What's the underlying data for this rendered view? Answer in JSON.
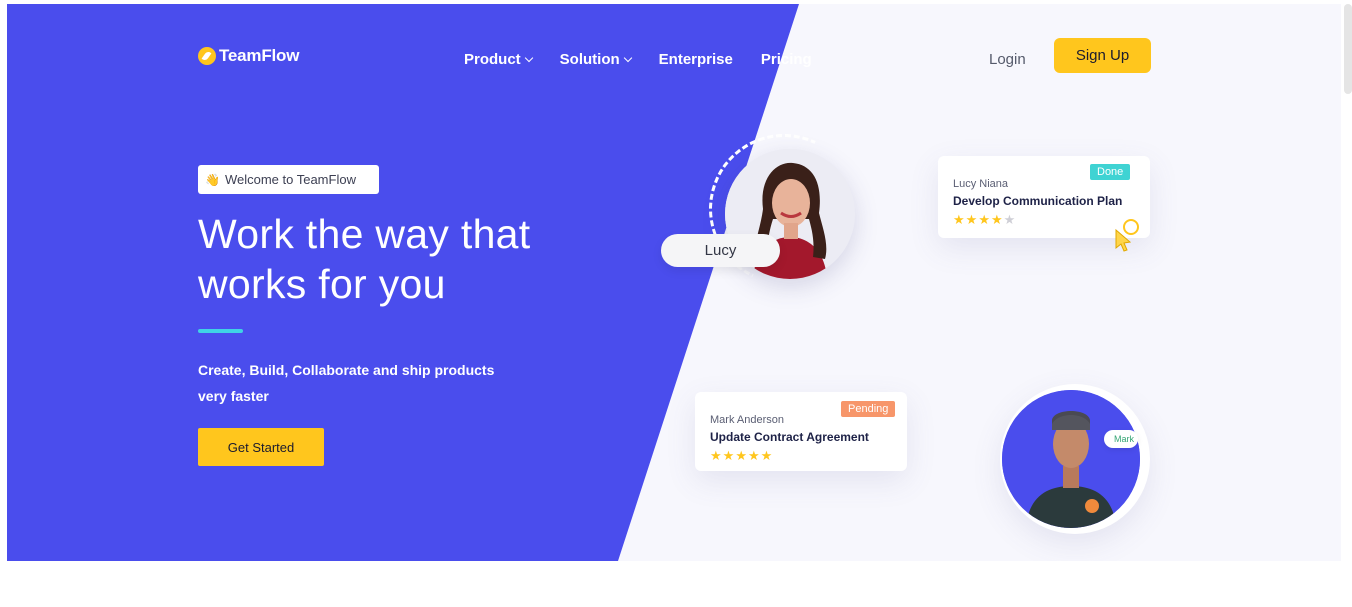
{
  "brand": {
    "name": "TeamFlow",
    "accent": "#ffc61d",
    "primary": "#4a4ded"
  },
  "nav": {
    "items": [
      {
        "label": "Product",
        "has_dropdown": true
      },
      {
        "label": "Solution",
        "has_dropdown": true
      },
      {
        "label": "Enterprise",
        "has_dropdown": false
      },
      {
        "label": "Pricing",
        "has_dropdown": false
      }
    ],
    "login": "Login",
    "signup": "Sign Up"
  },
  "hero": {
    "badge": "Welcome to TeamFlow",
    "badge_icon": "waving-hand-icon",
    "headline_line1": "Work the way that",
    "headline_line2": "works for you",
    "sub_line1": "Create, Build, Collaborate and ship products",
    "sub_line2": "very faster",
    "cta": "Get Started"
  },
  "illustration": {
    "lucy_label": "Lucy",
    "mark_label": "Mark",
    "cards": [
      {
        "name": "Lucy Niana",
        "task": "Develop Communication Plan",
        "status": "Done",
        "status_color": "#3fd3d3",
        "rating": 4,
        "max": 5
      },
      {
        "name": "Mark Anderson",
        "task": "Update Contract Agreement",
        "status": "Pending",
        "status_color": "#f7966a",
        "rating": 5,
        "max": 5
      }
    ]
  }
}
